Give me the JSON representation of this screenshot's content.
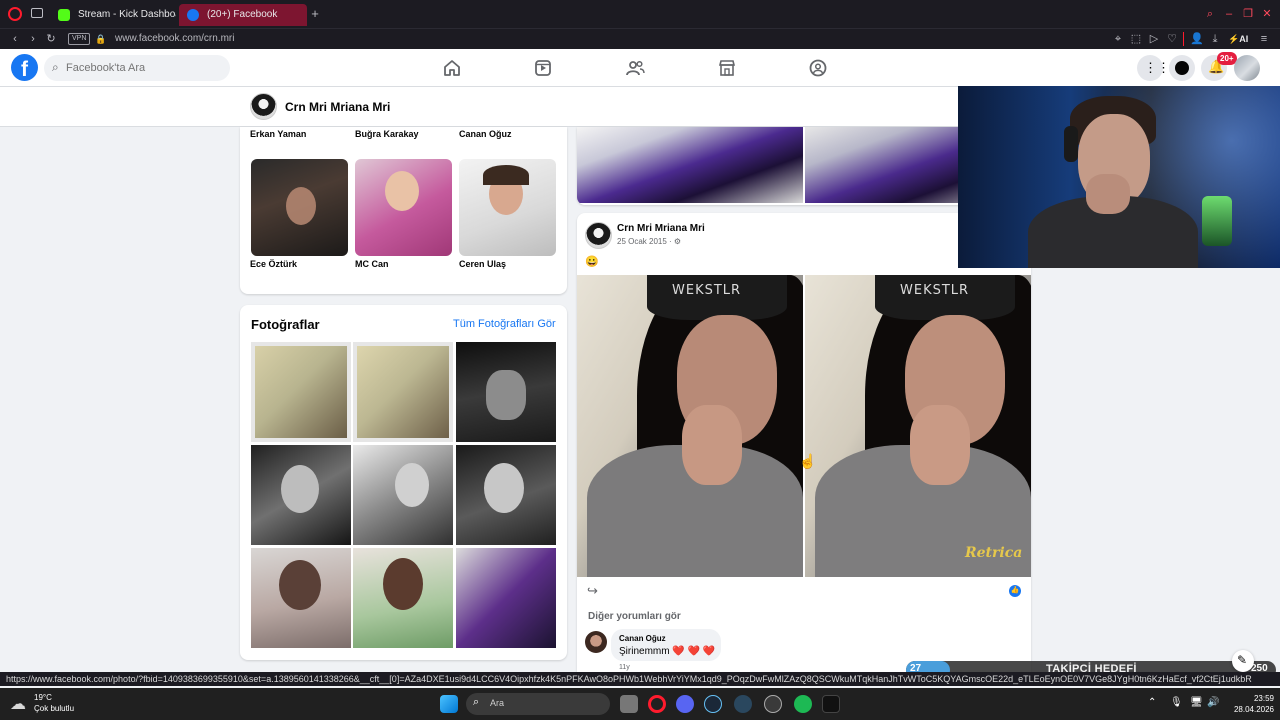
{
  "browser": {
    "tabs": [
      {
        "label": "Stream - Kick Dashboard",
        "color": "#53fc18"
      },
      {
        "label": "(20+) Facebook",
        "color": "#1877f2"
      }
    ],
    "url": "www.facebook.com/crn.mri",
    "vpn_label": "VPN",
    "ai_label": "AI"
  },
  "facebook": {
    "search_placeholder": "Facebook'ta Ara",
    "notification_badge": "20+",
    "profile_name": "Crn Mri Mriana Mri",
    "friends_row1": [
      "Erkan Yaman",
      "Buğra Karakay",
      "Canan Oğuz"
    ],
    "friends_row2": [
      "Ece Öztürk",
      "MC Can",
      "Ceren Ulaş"
    ],
    "photos": {
      "title": "Fotoğraflar",
      "see_all": "Tüm Fotoğrafları Gör"
    },
    "post": {
      "author": "Crn Mri Mriana Mri",
      "date": "25 Ocak 2015 · ",
      "emoji": "😀",
      "photo_watermark": "Retrica",
      "photo_caption_top": "WEKSTLR",
      "more_comments": "Diğer yorumları gör",
      "comment_author": "Canan Oğuz",
      "comment_text": "Şirinemmm ❤️ ❤️ ❤️",
      "comment_meta": "11y"
    }
  },
  "overlay": {
    "goal_label": "TAKİPÇİ HEDEFİ",
    "goal_current": "27",
    "goal_target": "250",
    "goal_progress": 0.108
  },
  "statusbar": {
    "url": "https://www.facebook.com/photo/?fbid=1409383699355910&set=a.1389560141338266&__cft__[0]=AZa4DXE1usi9d4LCC6V4Oipxhfzk4K5nPFKAwO8oPHWb1WebhVrYiYMx1qd9_POqzDwFwMlZAzQ8QSCWkuMTqkHanJhTvWToC5KQYAGmscOE22d_eTLEoEynOE0V7VGe8JYgH0tn6KzHaEcf_vf2CtEj1udkbR"
  },
  "taskbar": {
    "weather_temp": "19°C",
    "weather_desc": "Çok bulutlu",
    "search_label": "Ara",
    "time": "23:59",
    "date": "28.04.2026"
  },
  "colors": {
    "fb_blue": "#1877f2",
    "opera_red": "#ff1b2d",
    "tab_active": "#7d1530"
  }
}
